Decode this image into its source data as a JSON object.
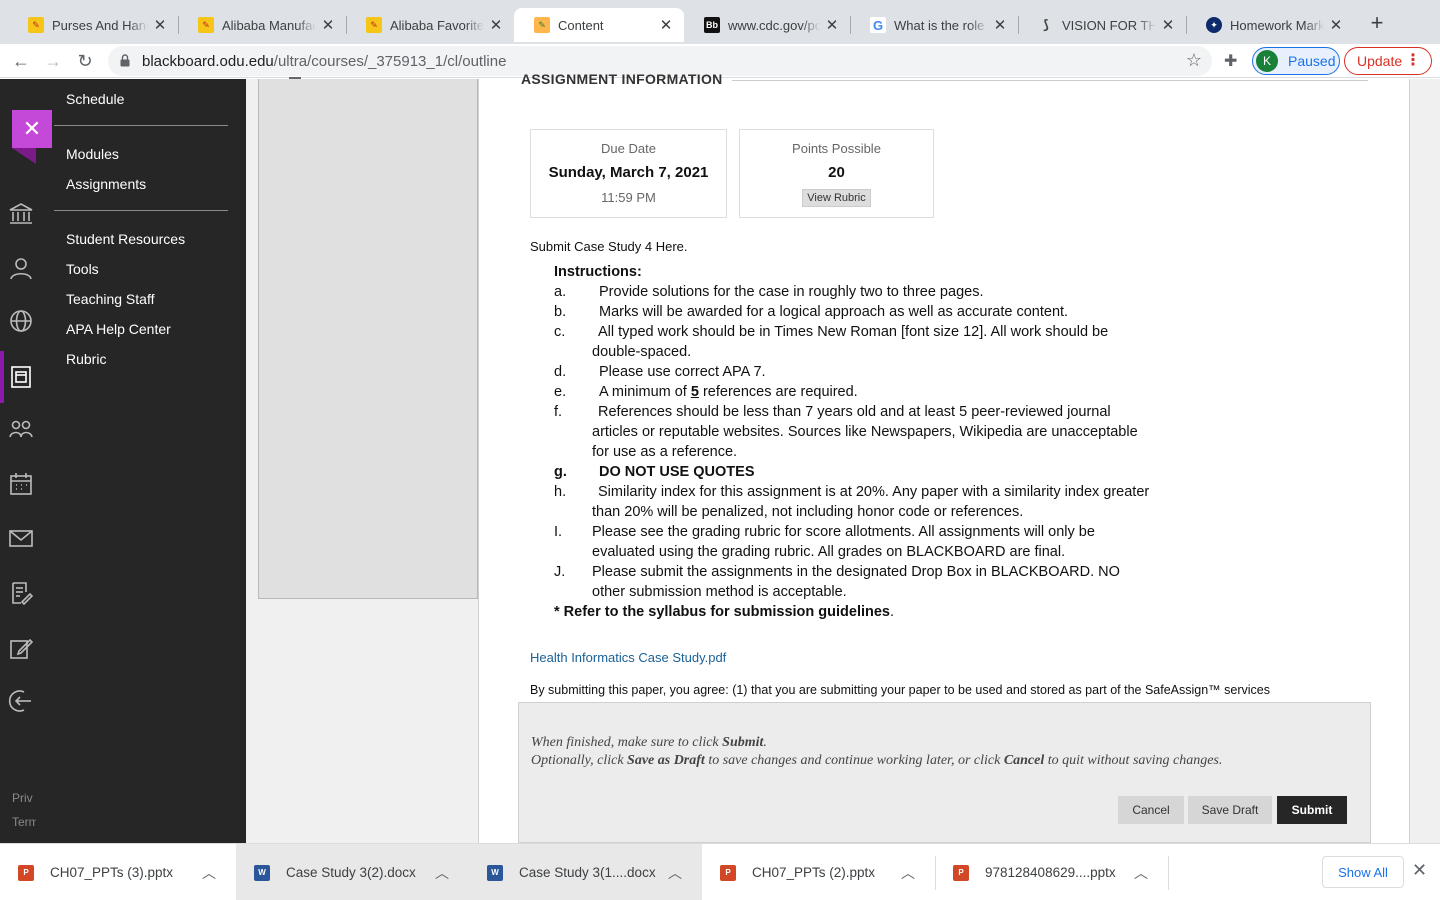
{
  "browser": {
    "tabs": [
      {
        "title": "Purses And Handbags",
        "favicon": "alibaba-icon",
        "active": false
      },
      {
        "title": "Alibaba Manufacturer",
        "favicon": "alibaba-icon",
        "active": false
      },
      {
        "title": "Alibaba Favorites",
        "favicon": "alibaba-icon",
        "active": false
      },
      {
        "title": "Content",
        "favicon": "pencil-icon",
        "active": true
      },
      {
        "title": "www.cdc.gov/pcd/",
        "favicon": "blackboard-icon",
        "active": false
      },
      {
        "title": "What is the role of",
        "favicon": "google-icon",
        "active": false
      },
      {
        "title": "VISION FOR THE F",
        "favicon": "link-icon",
        "active": false
      },
      {
        "title": "Homework Market",
        "favicon": "homework-icon",
        "active": false
      }
    ],
    "url_host": "blackboard.odu.edu",
    "url_path": "/ultra/courses/_375913_1/cl/outline",
    "profile_initial": "K",
    "profile_label": "Paused",
    "update_label": "Update"
  },
  "rail": {
    "footer_privacy": "Priv",
    "footer_terms": "Term"
  },
  "course_menu": {
    "items": [
      "Schedule",
      "Modules",
      "Assignments",
      "Student Resources",
      "Tools",
      "Teaching Staff",
      "APA Help Center",
      "Rubric"
    ]
  },
  "assignment": {
    "section_heading": "ASSIGNMENT INFORMATION",
    "due_label": "Due Date",
    "due_date": "Sunday, March 7, 2021",
    "due_time": "11:59 PM",
    "points_label": "Points Possible",
    "points_value": "20",
    "view_rubric": "View Rubric",
    "submit_line": "Submit Case Study 4 Here.",
    "instructions_heading": "Instructions:",
    "instructions": [
      {
        "letter": "a.",
        "text": "Provide solutions for the case in roughly two to three pages."
      },
      {
        "letter": "b.",
        "text": "Marks will be awarded for a logical approach as well as accurate content."
      },
      {
        "letter": "c.",
        "text": "All typed work should be in Times New Roman [font size 12]. All work should be double-spaced."
      },
      {
        "letter": "d.",
        "text": "Please use correct APA 7."
      },
      {
        "letter": "e.",
        "text_before": "A minimum of ",
        "text_num": "5",
        "text_after": " references are required."
      },
      {
        "letter": "f.",
        "text": "References should be less than 7 years old and at least 5 peer-reviewed journal articles or reputable websites. Sources like Newspapers, Wikipedia are unacceptable for use as a reference."
      },
      {
        "letter": "g.",
        "text": "DO NOT USE QUOTES"
      },
      {
        "letter": "h.",
        "text": "Similarity index for this assignment is at 20%. Any paper with a similarity index greater than 20% will be penalized, not including honor code  or references."
      },
      {
        "letter": "I.",
        "text": "Please see the grading rubric for score allotments. All assignments will only be evaluated using the grading rubric. All grades on BLACKBOARD are final."
      },
      {
        "letter": "J.",
        "text": "Please submit the assignments in the designated Drop Box in BLACKBOARD. NO other submission method is acceptable."
      }
    ],
    "footnote": "* Refer to the syllabus for submission guidelines",
    "footnote_end": ".",
    "attachment": "Health Informatics Case Study.pdf",
    "agreement": "By submitting this paper, you agree: (1) that you are submitting your paper to be used and stored as part of the SafeAssign™ services"
  },
  "submit_panel": {
    "line1_a": "When finished, make sure to click ",
    "line1_b": "Submit",
    "line1_c": ".",
    "line2_a": "Optionally, click ",
    "line2_b": "Save as Draft",
    "line2_c": " to save changes and continue working later, or click ",
    "line2_d": "Cancel",
    "line2_e": " to quit without saving changes.",
    "cancel": "Cancel",
    "save_draft": "Save Draft",
    "submit": "Submit"
  },
  "downloads": {
    "items": [
      {
        "name": "CH07_PPTs (3).pptx",
        "type": "ppt"
      },
      {
        "name": "Case Study 3(2).docx",
        "type": "doc"
      },
      {
        "name": "Case Study 3(1....docx",
        "type": "doc"
      },
      {
        "name": "CH07_PPTs (2).pptx",
        "type": "ppt"
      },
      {
        "name": "978128408629....pptx",
        "type": "ppt"
      }
    ],
    "show_all": "Show All"
  }
}
